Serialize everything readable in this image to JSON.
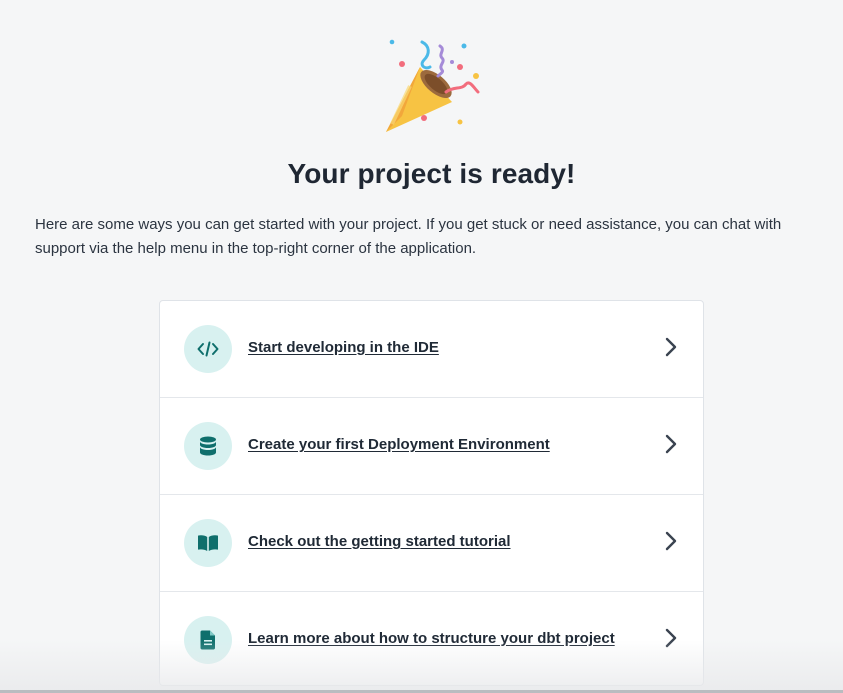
{
  "page": {
    "title": "Your project is ready!",
    "intro": "Here are some ways you can get started with your project. If you get stuck or need assistance, you can chat with support via the help menu in the top-right corner of the application."
  },
  "actions": [
    {
      "label": "Start developing in the IDE",
      "icon": "code-icon"
    },
    {
      "label": "Create your first Deployment Environment",
      "icon": "database-icon"
    },
    {
      "label": "Check out the getting started tutorial",
      "icon": "book-icon"
    },
    {
      "label": "Learn more about how to structure your dbt project",
      "icon": "document-icon"
    }
  ],
  "colors": {
    "accent": "#0f6f6c",
    "badge_bg": "#d8f1f0",
    "text": "#1f2733",
    "background": "#f5f6f7"
  }
}
